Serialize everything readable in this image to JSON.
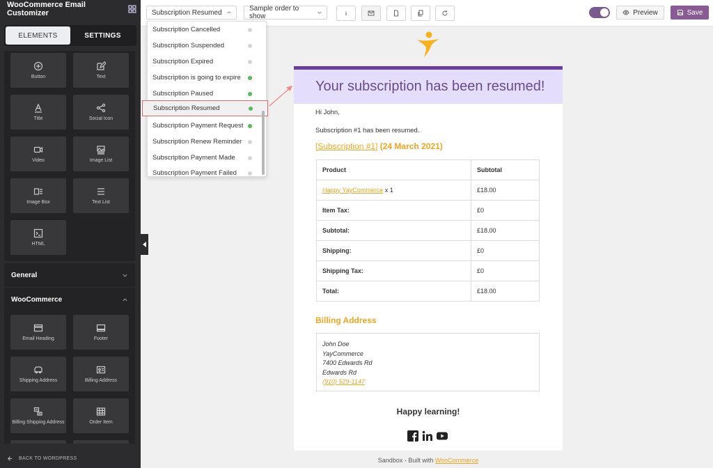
{
  "sidebar": {
    "title": "WooCommerce Email Customizer",
    "tabs": [
      {
        "label": "ELEMENTS"
      },
      {
        "label": "SETTINGS"
      }
    ],
    "elements": [
      {
        "label": "Button",
        "icon": "plus-circle-icon"
      },
      {
        "label": "Text",
        "icon": "edit-icon"
      },
      {
        "label": "Title",
        "icon": "letter-a-icon"
      },
      {
        "label": "Social Icon",
        "icon": "share-icon"
      },
      {
        "label": "Video",
        "icon": "video-icon"
      },
      {
        "label": "Image List",
        "icon": "image-list-icon"
      },
      {
        "label": "Image Box",
        "icon": "image-box-icon"
      },
      {
        "label": "Text List",
        "icon": "list-icon"
      },
      {
        "label": "HTML",
        "icon": "terminal-icon"
      }
    ],
    "sections": [
      {
        "label": "General"
      },
      {
        "label": "WooCommerce"
      }
    ],
    "woo_elements": [
      {
        "label": "Email Heading",
        "icon": "email-heading-icon"
      },
      {
        "label": "Footer",
        "icon": "footer-icon"
      },
      {
        "label": "Shipping Address",
        "icon": "truck-icon"
      },
      {
        "label": "Billing Address",
        "icon": "id-card-icon"
      },
      {
        "label": "Billing Shipping Address",
        "icon": "address-icon"
      },
      {
        "label": "Order Item",
        "icon": "table-icon"
      }
    ],
    "footer_label": "BACK TO WORDPRESS"
  },
  "toolbar": {
    "template_select": "Subscription Resumed",
    "order_select": "Sample order to show",
    "preview_label": "Preview",
    "save_label": "Save"
  },
  "dropdown": {
    "items": [
      {
        "label": "Subscription Cancelled",
        "status": "inactive"
      },
      {
        "label": "Subscription Suspended",
        "status": "inactive"
      },
      {
        "label": "Subscription Expired",
        "status": "inactive"
      },
      {
        "label": "Subscription is going to expire",
        "status": "active"
      },
      {
        "label": "Subscription Paused",
        "status": "active"
      },
      {
        "label": "Subscription Resumed",
        "status": "active"
      },
      {
        "label": "Subscription Payment Request",
        "status": "active"
      },
      {
        "label": "Subscription Renew Reminder",
        "status": "inactive"
      },
      {
        "label": "Subscription Payment Made",
        "status": "inactive"
      },
      {
        "label": "Subscription Payment Failed",
        "status": "inactive"
      }
    ],
    "selected_index": 5
  },
  "colors": {
    "accent": "#8a5a95",
    "hero_bg": "#e4ddfb",
    "hero_text": "#6a4b8c",
    "link": "#f2a51f",
    "status_active": "#5cb85c",
    "status_inactive": "#d6d6d6"
  },
  "email": {
    "heading": "Your subscription has been resumed!",
    "greeting": "Hi John,",
    "message": "Subscription #1 has been resumed.",
    "subscription_link": "[Subscription #1]",
    "subscription_date": "(24 March 2021)",
    "table": {
      "headers": [
        "Product",
        "Subtotal"
      ],
      "product_name": "Happy YayCommerce",
      "product_qty": " x 1",
      "product_price": "£18.00",
      "rows": [
        {
          "label": "Item Tax:",
          "value": "£0"
        },
        {
          "label": "Subtotal:",
          "value": "£18.00"
        },
        {
          "label": "Shipping:",
          "value": "£0"
        },
        {
          "label": "Shipping Tax:",
          "value": "£0"
        },
        {
          "label": "Total:",
          "value": "£18.00"
        }
      ]
    },
    "billing_title": "Billing Address",
    "address": [
      "John Doe",
      "YayCommerce",
      "7400 Edwards Rd",
      "Edwards Rd"
    ],
    "phone": "(910) 529-1147",
    "closing": "Happy learning!",
    "social_icons": [
      "facebook-icon",
      "linkedin-icon",
      "youtube-icon"
    ]
  },
  "sandbox": {
    "prefix": "Sandbox - Built with ",
    "link": "WooCommerce"
  }
}
